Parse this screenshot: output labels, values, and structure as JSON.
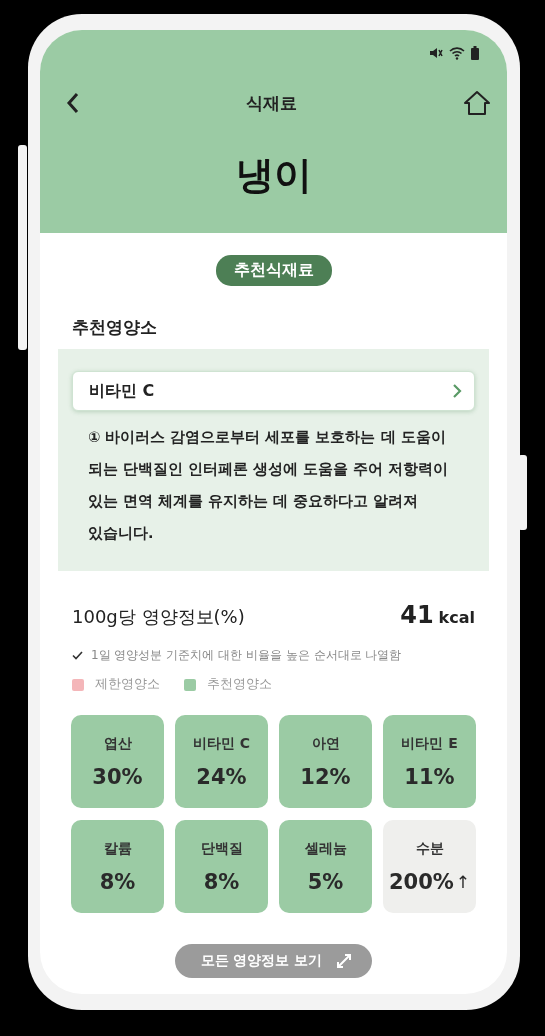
{
  "header": {
    "title": "식재료",
    "name": "냉이"
  },
  "tag": "추천식재료",
  "recommended": {
    "title": "추천영양소",
    "selector": "비타민 C",
    "description": "① 바이러스 감염으로부터 세포를 보호하는 데 도움이 되는 단백질인 인터페론 생성에 도움을 주어 저항력이 있는 면역 체계를 유지하는 데 중요하다고 알려져 있습니다."
  },
  "nutrition": {
    "title": "100g당 영양정보(%)",
    "kcal_value": "41",
    "kcal_unit": "kcal",
    "note": "1일 영양성분 기준치에 대한 비율을 높은 순서대로 나열함",
    "legend": [
      {
        "label": "제한영양소",
        "color": "#f4b6b9"
      },
      {
        "label": "추천영양소",
        "color": "#9bcba4"
      }
    ],
    "tiles": [
      {
        "name": "엽산",
        "value": "30%",
        "kind": "recommended"
      },
      {
        "name": "비타민 C",
        "value": "24%",
        "kind": "recommended"
      },
      {
        "name": "아연",
        "value": "12%",
        "kind": "recommended"
      },
      {
        "name": "비타민 E",
        "value": "11%",
        "kind": "recommended"
      },
      {
        "name": "칼륨",
        "value": "8%",
        "kind": "recommended"
      },
      {
        "name": "단백질",
        "value": "8%",
        "kind": "recommended"
      },
      {
        "name": "셀레늄",
        "value": "5%",
        "kind": "recommended"
      },
      {
        "name": "수분",
        "value": "200%",
        "arrow": "↑",
        "kind": "neutral"
      }
    ]
  },
  "more_button": "모든 영양정보 보기"
}
